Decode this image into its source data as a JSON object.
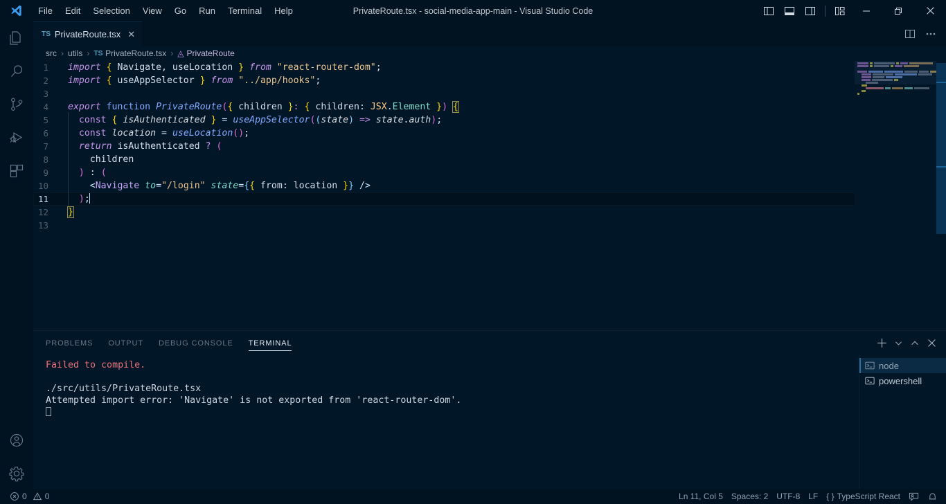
{
  "window": {
    "title": "PrivateRoute.tsx - social-media-app-main - Visual Studio Code",
    "menu": [
      "File",
      "Edit",
      "Selection",
      "View",
      "Go",
      "Run",
      "Terminal",
      "Help"
    ],
    "controls": {
      "panel_left": "toggle-primary-sidebar",
      "panel_bottom": "toggle-panel",
      "panel_right": "toggle-secondary-sidebar",
      "layout": "customize-layout",
      "minimize": "—",
      "restore": "restore-window",
      "close": "✕"
    }
  },
  "activitybar": {
    "items": [
      {
        "name": "explorer",
        "label": "Explorer"
      },
      {
        "name": "search",
        "label": "Search"
      },
      {
        "name": "source-control",
        "label": "Source Control"
      },
      {
        "name": "run-debug",
        "label": "Run and Debug"
      },
      {
        "name": "extensions",
        "label": "Extensions"
      }
    ],
    "bottom": [
      {
        "name": "accounts",
        "label": "Accounts"
      },
      {
        "name": "manage",
        "label": "Manage"
      }
    ]
  },
  "editor": {
    "tab": {
      "icon_text": "TS",
      "label": "PrivateRoute.tsx",
      "close": "✕"
    },
    "tab_actions": [
      "split-editor",
      "more-actions"
    ],
    "breadcrumb": [
      "src",
      "utils",
      "PrivateRoute.tsx",
      "PrivateRoute"
    ],
    "breadcrumb_file_icon": "TS",
    "cursor_line": 11,
    "lines": [
      {
        "n": 1,
        "text": "import { Navigate, useLocation } from \"react-router-dom\";"
      },
      {
        "n": 2,
        "text": "import { useAppSelector } from \"../app/hooks\";"
      },
      {
        "n": 3,
        "text": ""
      },
      {
        "n": 4,
        "text": "export function PrivateRoute({ children }: { children: JSX.Element }) {"
      },
      {
        "n": 5,
        "text": "  const { isAuthenticated } = useAppSelector((state) => state.auth);"
      },
      {
        "n": 6,
        "text": "  const location = useLocation();"
      },
      {
        "n": 7,
        "text": "  return isAuthenticated ? ("
      },
      {
        "n": 8,
        "text": "    children"
      },
      {
        "n": 9,
        "text": "  ) : ("
      },
      {
        "n": 10,
        "text": "    <Navigate to=\"/login\" state={{ from: location }} />"
      },
      {
        "n": 11,
        "text": "  );"
      },
      {
        "n": 12,
        "text": "}"
      },
      {
        "n": 13,
        "text": ""
      }
    ]
  },
  "panel": {
    "tabs": [
      "PROBLEMS",
      "OUTPUT",
      "DEBUG CONSOLE",
      "TERMINAL"
    ],
    "active_tab": "TERMINAL",
    "actions": [
      "new-terminal",
      "split-terminal-dropdown",
      "maximize-panel",
      "close-panel"
    ],
    "terminal_output": [
      {
        "text": "Failed to compile.",
        "color": "#f07178"
      },
      {
        "text": "",
        "color": "#cdd6df"
      },
      {
        "text": "./src/utils/PrivateRoute.tsx",
        "color": "#cdd6df"
      },
      {
        "text": "Attempted import error: 'Navigate' is not exported from 'react-router-dom'.",
        "color": "#cdd6df"
      }
    ],
    "terminal_instances": [
      {
        "label": "node",
        "selected": true
      },
      {
        "label": "powershell",
        "selected": false
      }
    ]
  },
  "statusbar": {
    "errors": "0",
    "warnings": "0",
    "position": "Ln 11, Col 5",
    "spaces": "Spaces: 2",
    "encoding": "UTF-8",
    "eol": "LF",
    "language": "TypeScript React",
    "language_prefix": "{ }",
    "right_icons": [
      "feedback-icon",
      "bell-icon"
    ]
  },
  "colors": {
    "bg": "#011627",
    "chrome": "#011221",
    "accent": "#82aaff",
    "error": "#f07178",
    "keyword": "#c792ea",
    "string": "#ecc48d"
  }
}
